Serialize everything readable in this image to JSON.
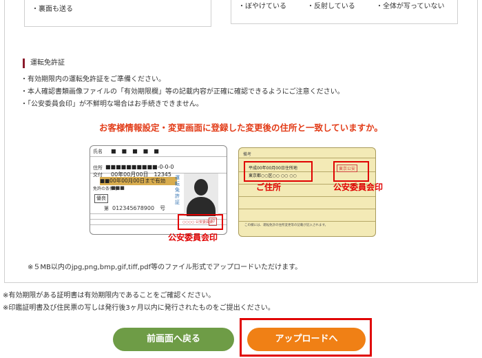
{
  "top_boxes": {
    "left_item": "・裏面も送る",
    "right_items": [
      "・ぼやけている",
      "・反射している",
      "・全体が写っていない"
    ]
  },
  "license_section": {
    "title": "運転免許証",
    "notes": [
      "・有効期限内の運転免許証をご準備ください。",
      "・本人確認書類画像ファイルの「有効期限欄」等の記載内容が正確に確認できるようにご注意ください。",
      "・「公安委員会印」が不鮮明な場合はお手続きできません。"
    ],
    "address_heading": "お客様情報設定・変更画面に登録した変更後の住所と一致していますか。"
  },
  "card_front": {
    "name_label": "氏名",
    "name_value": "■　■　■　■　■",
    "address_label": "住所",
    "address_value": "■■■■■■■■■■-0-0-0",
    "issue_label": "交付",
    "issue_value": "00年00月00日　12345",
    "expiry_text": "■■00年00月00日まで有効",
    "license_label": "免許の条件等",
    "license_value": "■■■",
    "badge": "優良",
    "number_label": "第",
    "number_value": "012345678900　号",
    "side_text": "運転免許証",
    "seal_text": "○○○○ 公安委員会",
    "seal_mark": "印",
    "callout": "公安委員会印"
  },
  "card_back": {
    "header": "備考",
    "entry_text": "平成00年00月00日住所地",
    "entry_sub": "東京都○○区○○ ○○ ○○",
    "seal_text": "東京公安",
    "address_callout": "ご住所",
    "seal_callout": "公安委員会印",
    "footer_text": "この欄には、運転免許の住所変更等の記載が記入されます。"
  },
  "file_note": "※５MB以内のjpg,png,bmp,gif,tiff,pdf等のファイル形式でアップロードいただけます。",
  "footer_notes": [
    "※有効期限がある証明書は有効期限内であることをご確認ください。",
    "※印鑑証明書及び住民票の写しは発行後3ヶ月以内に発行されたものをご提出ください。"
  ],
  "buttons": {
    "back": "前画面へ戻る",
    "upload": "アップロードへ"
  },
  "colors": {
    "accent_red": "#e00000",
    "heading_red": "#e23b17",
    "back_button": "#6e9c46",
    "upload_button": "#f08015",
    "section_marker": "#8b1a2b"
  }
}
